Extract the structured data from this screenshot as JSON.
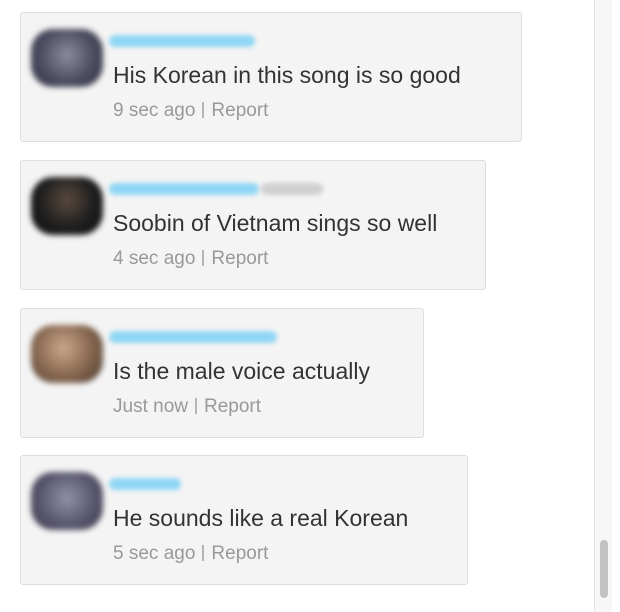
{
  "comments": [
    {
      "text": "His Korean in this song is so good",
      "time": "9 sec ago",
      "report_label": "Report",
      "avatar_color": "#5a5a6e",
      "username_color": "#7fd1f2"
    },
    {
      "text": "Soobin of Vietnam sings so well",
      "time": "4 sec ago",
      "report_label": "Report",
      "avatar_color": "#2a2a2a",
      "username_color": "#7fd1f2"
    },
    {
      "text": "Is the male voice actually",
      "time": "Just now",
      "report_label": "Report",
      "avatar_color": "#8a7260",
      "username_color": "#7fd1f2"
    },
    {
      "text": "He sounds like a real Korean",
      "time": "5 sec ago",
      "report_label": "Report",
      "avatar_color": "#6a6880",
      "username_color": "#7fd1f2"
    }
  ],
  "colors": {
    "card_background": "#f4f4f4",
    "card_border": "#dedede",
    "text": "#333333",
    "meta_text": "#999999"
  }
}
